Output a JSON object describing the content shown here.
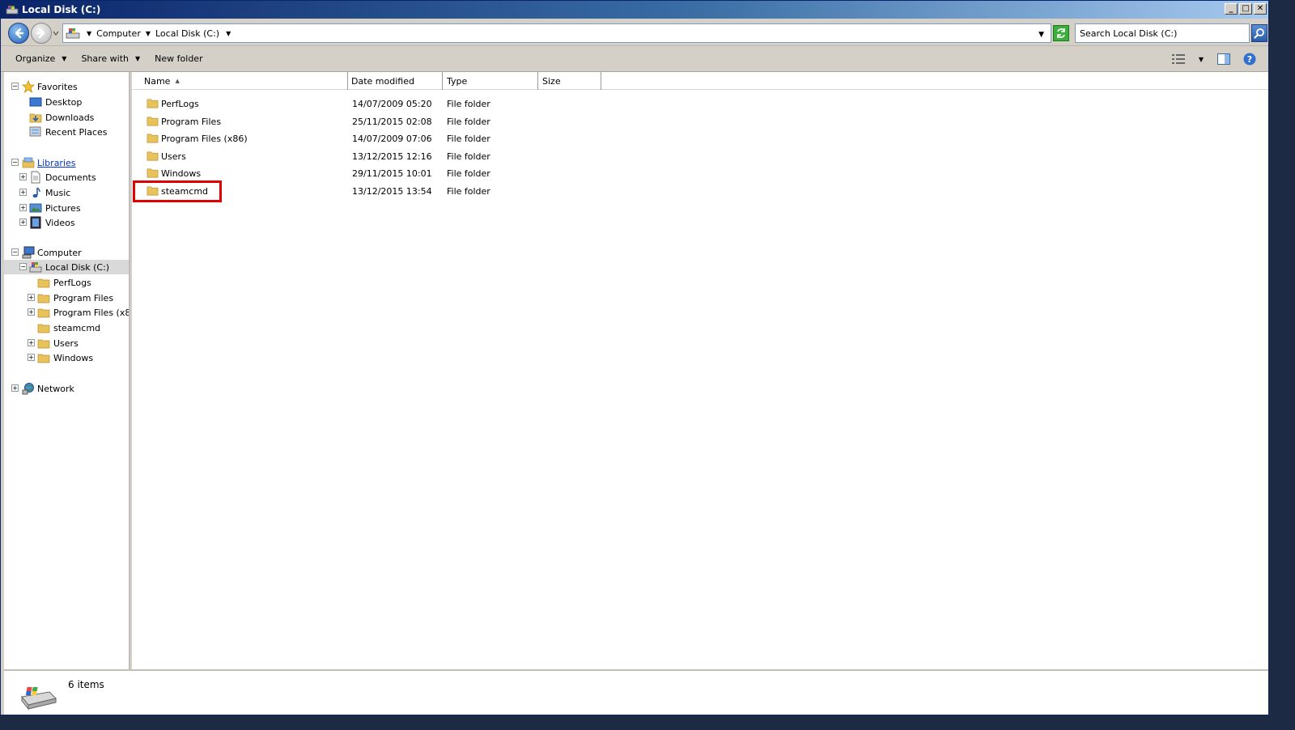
{
  "window": {
    "title": "Local Disk (C:)",
    "controls": {
      "minimize": "_",
      "maximize": "□",
      "close": "✕"
    }
  },
  "address": {
    "crumbs": [
      "Computer",
      "Local Disk (C:)"
    ],
    "search_placeholder": "Search Local Disk (C:)"
  },
  "commandbar": {
    "organize": "Organize",
    "share_with": "Share with",
    "new_folder": "New folder"
  },
  "navpane": {
    "favorites": {
      "label": "Favorites",
      "items": [
        "Desktop",
        "Downloads",
        "Recent Places"
      ]
    },
    "libraries": {
      "label": "Libraries",
      "items": [
        "Documents",
        "Music",
        "Pictures",
        "Videos"
      ]
    },
    "computer": {
      "label": "Computer",
      "drive": "Local Disk (C:)",
      "folders": [
        "PerfLogs",
        "Program Files",
        "Program Files (x86)",
        "steamcmd",
        "Users",
        "Windows"
      ]
    },
    "network": {
      "label": "Network"
    }
  },
  "columns": {
    "name": "Name",
    "date": "Date modified",
    "type": "Type",
    "size": "Size"
  },
  "files": [
    {
      "name": "PerfLogs",
      "date": "14/07/2009 05:20",
      "type": "File folder"
    },
    {
      "name": "Program Files",
      "date": "25/11/2015 02:08",
      "type": "File folder"
    },
    {
      "name": "Program Files (x86)",
      "date": "14/07/2009 07:06",
      "type": "File folder"
    },
    {
      "name": "Users",
      "date": "13/12/2015 12:16",
      "type": "File folder"
    },
    {
      "name": "Windows",
      "date": "29/11/2015 10:01",
      "type": "File folder"
    },
    {
      "name": "steamcmd",
      "date": "13/12/2015 13:54",
      "type": "File folder"
    }
  ],
  "status": {
    "count": "6 items"
  },
  "colors": {
    "highlight": "#e00000",
    "folder": "#e8c25a",
    "link": "#0033cc"
  }
}
